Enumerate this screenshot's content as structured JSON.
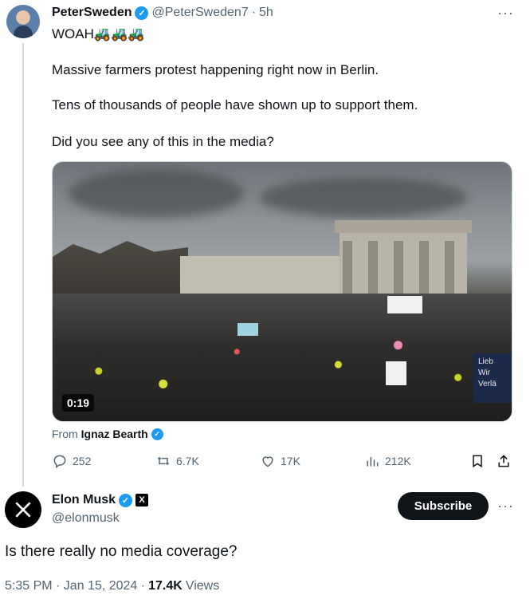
{
  "tweet": {
    "author_name": "PeterSweden",
    "author_handle": "@PeterSweden7",
    "separator": "·",
    "time_ago": "5h",
    "more_label": "···",
    "lines": [
      "WOAH🚜🚜🚜",
      "Massive farmers protest happening right now in Berlin.",
      "Tens of thousands of people have shown up to support them.",
      "Did you see any of this in the media?"
    ],
    "media": {
      "duration": "0:19",
      "sign_text": "Lieb Wir Verlä"
    },
    "from_label": "From",
    "from_author": "Ignaz Bearth",
    "actions": {
      "replies": "252",
      "reposts": "6.7K",
      "likes": "17K",
      "views": "212K"
    }
  },
  "reply": {
    "author_name": "Elon Musk",
    "author_handle": "@elonmusk",
    "subscribe_label": "Subscribe",
    "more_label": "···",
    "text": "Is there really no media coverage?",
    "timestamp": "5:35 PM · Jan 15, 2024 ·",
    "views_count": "17.4K",
    "views_label": "Views"
  },
  "colors": {
    "verified_blue": "#1d9bf0",
    "text_primary": "#0f1419",
    "text_secondary": "#536471",
    "thread_line": "#cfd9de"
  },
  "icons": [
    "reply-icon",
    "repost-icon",
    "like-icon",
    "views-icon",
    "bookmark-icon",
    "share-icon",
    "x-logo-icon"
  ]
}
